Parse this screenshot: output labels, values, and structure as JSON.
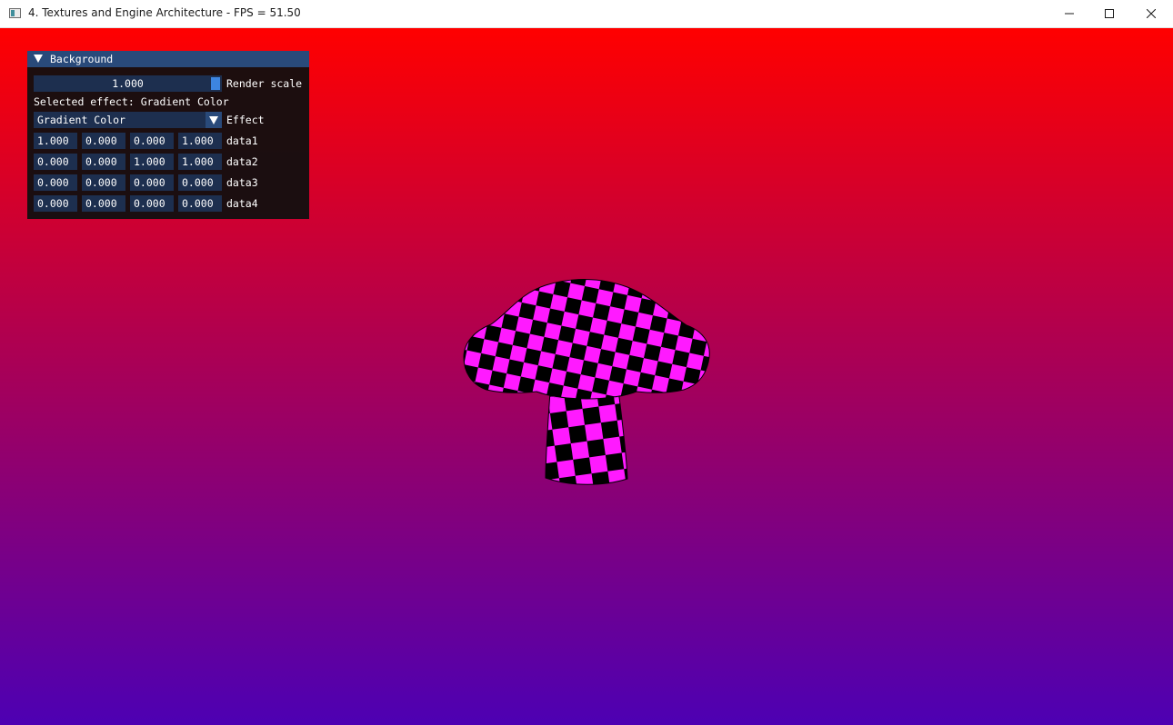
{
  "window": {
    "title": "4. Textures and Engine Architecture - FPS = 51.50"
  },
  "background": {
    "gradient_top": "#ff0000",
    "gradient_bottom": "#4d00b3"
  },
  "panel": {
    "header": "Background",
    "render_scale": {
      "value": "1.000",
      "label": "Render scale"
    },
    "selected_effect_text": "Selected effect: Gradient Color",
    "effect": {
      "value": "Gradient Color",
      "label": "Effect"
    },
    "rows": [
      {
        "label": "data1",
        "values": [
          "1.000",
          "0.000",
          "0.000",
          "1.000"
        ]
      },
      {
        "label": "data2",
        "values": [
          "0.000",
          "0.000",
          "1.000",
          "1.000"
        ]
      },
      {
        "label": "data3",
        "values": [
          "0.000",
          "0.000",
          "0.000",
          "0.000"
        ]
      },
      {
        "label": "data4",
        "values": [
          "0.000",
          "0.000",
          "0.000",
          "0.000"
        ]
      }
    ]
  },
  "model": {
    "name": "mushroom-mesh",
    "texture_colors": [
      "#ff1aff",
      "#000000"
    ]
  }
}
